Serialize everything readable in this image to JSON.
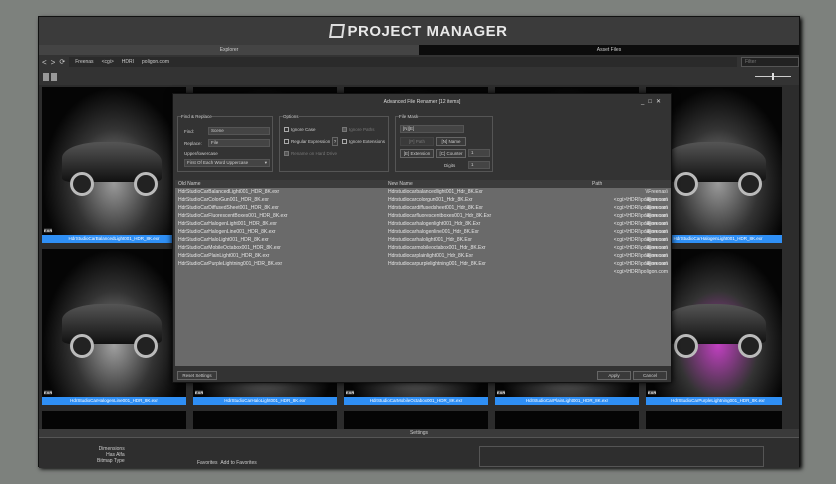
{
  "app": {
    "title": "PROJECT MANAGER"
  },
  "tabs": [
    "Explorer",
    "Asset Files"
  ],
  "nav": {
    "back": "<",
    "forward": ">",
    "refresh": "⟳",
    "breadcrumb": [
      "Freenas",
      "<cgi>",
      "HDRI",
      "poligon.com"
    ],
    "filter_placeholder": "Filter"
  },
  "tiles": [
    "HdrStudioCarBalancedLight001_HDR_8K.exr",
    "",
    "",
    "",
    "HdrStudioCarHalogenLight001_HDR_8K.exr",
    "HdrStudioCarHalogenLine001_HDR_8K.exr",
    "HdrStudioCarHaloLight001_HDR_8K.exr",
    "HdrStudioCarMobileOctabox001_HDR_8K.exr",
    "HdrStudioCarPlainLight001_HDR_8K.exr",
    "HdrStudioCarPurpleLightning001_HDR_8K.exr"
  ],
  "tile_badge": "EXR",
  "settings_label": "Settings",
  "bottom": {
    "props": [
      "Dimensions",
      "Has Alfa",
      "Bitmap Type"
    ],
    "favorites": "Favorites",
    "add_fav": "Add to Favorites"
  },
  "dialog": {
    "title": "Advanced File Renamer [12 items]",
    "find_replace": {
      "legend": "Find & Replace",
      "find_label": "Find:",
      "find_value": "Scene",
      "replace_label": "Replace:",
      "replace_value": "File",
      "case_label": "Upper/lowercase",
      "case_value": "First Of Each Word Uppercase"
    },
    "options": {
      "legend": "Options",
      "ignore_case": "Ignore Case",
      "ignore_paths": "Ignore Paths",
      "regex": "Regular Expression",
      "regex_help": "?",
      "ignore_ext": "Ignore Extensions",
      "rename_disk": "Rename on Hard Drive"
    },
    "mask": {
      "legend": "File Mask",
      "value": "[N][E]",
      "path": "[P] Path",
      "name": "[N] Name",
      "ext": "[E] Extension",
      "counter": "[C] Counter",
      "counter_value": "1",
      "digits_label": "Digits",
      "digits_value": "1"
    },
    "columns": [
      "Old Name",
      "New Name",
      "Path"
    ],
    "rows": [
      [
        "HdrStudioCarBalancedLight001_HDR_8K.exr",
        "Hdrstudiocarbalancedlight001_Hdr_8K.Exr",
        "\\\\Freenas\\<cgi>\\HDRI\\poligon.com"
      ],
      [
        "HdrStudioCarColorGun001_HDR_8K.exr",
        "Hdrstudiocarcolorgun001_Hdr_8K.Exr",
        "\\\\Freenas\\<cgi>\\HDRI\\poligon.com"
      ],
      [
        "HdrStudioCarDiffusedSheet001_HDR_8K.exr",
        "Hdrstudiocardiffusedsheet001_Hdr_8K.Exr",
        "\\\\Freenas\\<cgi>\\HDRI\\poligon.com"
      ],
      [
        "HdrStudioCarFluorescentBoxes001_HDR_8K.exr",
        "Hdrstudiocarfluorescentboxes001_Hdr_8K.Exr",
        "\\\\Freenas\\<cgi>\\HDRI\\poligon.com"
      ],
      [
        "HdrStudioCarHalogenLight001_HDR_8K.exr",
        "Hdrstudiocarhalogenlight001_Hdr_8K.Exr",
        "\\\\Freenas\\<cgi>\\HDRI\\poligon.com"
      ],
      [
        "HdrStudioCarHalogenLine001_HDR_8K.exr",
        "Hdrstudiocarhalogenline001_Hdr_8K.Exr",
        "\\\\Freenas\\<cgi>\\HDRI\\poligon.com"
      ],
      [
        "HdrStudioCarHaloLight001_HDR_8K.exr",
        "Hdrstudiocarhalolight001_Hdr_8K.Exr",
        "\\\\Freenas\\<cgi>\\HDRI\\poligon.com"
      ],
      [
        "HdrStudioCarMobileOctabox001_HDR_8K.exr",
        "Hdrstudiocarmobileoctabox001_Hdr_8K.Exr",
        "\\\\Freenas\\<cgi>\\HDRI\\poligon.com"
      ],
      [
        "HdrStudioCarPlainLight001_HDR_8K.exr",
        "Hdrstudiocarplainlight001_Hdr_8K.Exr",
        "\\\\Freenas\\<cgi>\\HDRI\\poligon.com"
      ],
      [
        "HdrStudioCarPurpleLightning001_HDR_8K.exr",
        "Hdrstudiocarpurplelightning001_Hdr_8K.Exr",
        "\\\\Freenas\\<cgi>\\HDRI\\poligon.com"
      ]
    ],
    "reset": "Reset Settings",
    "apply": "Apply",
    "cancel": "Cancel"
  }
}
